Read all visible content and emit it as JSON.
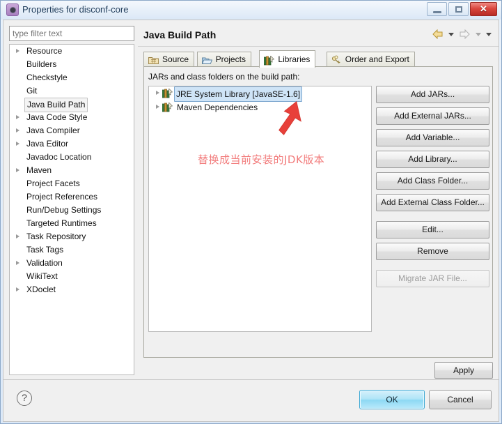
{
  "window": {
    "title": "Properties for disconf-core",
    "icon": "properties-icon",
    "controls": {
      "minimize": "minimize-button",
      "maximize": "maximize-button",
      "close": "✕"
    }
  },
  "sidebar": {
    "filter": {
      "value": "",
      "placeholder": "type filter text"
    },
    "items": [
      {
        "label": "Resource",
        "expandable": true,
        "selected": false
      },
      {
        "label": "Builders",
        "expandable": false,
        "selected": false
      },
      {
        "label": "Checkstyle",
        "expandable": false,
        "selected": false
      },
      {
        "label": "Git",
        "expandable": false,
        "selected": false
      },
      {
        "label": "Java Build Path",
        "expandable": false,
        "selected": true
      },
      {
        "label": "Java Code Style",
        "expandable": true,
        "selected": false
      },
      {
        "label": "Java Compiler",
        "expandable": true,
        "selected": false
      },
      {
        "label": "Java Editor",
        "expandable": true,
        "selected": false
      },
      {
        "label": "Javadoc Location",
        "expandable": false,
        "selected": false
      },
      {
        "label": "Maven",
        "expandable": true,
        "selected": false
      },
      {
        "label": "Project Facets",
        "expandable": false,
        "selected": false
      },
      {
        "label": "Project References",
        "expandable": false,
        "selected": false
      },
      {
        "label": "Run/Debug Settings",
        "expandable": false,
        "selected": false
      },
      {
        "label": "Targeted Runtimes",
        "expandable": false,
        "selected": false
      },
      {
        "label": "Task Repository",
        "expandable": true,
        "selected": false
      },
      {
        "label": "Task Tags",
        "expandable": false,
        "selected": false
      },
      {
        "label": "Validation",
        "expandable": true,
        "selected": false
      },
      {
        "label": "WikiText",
        "expandable": false,
        "selected": false
      },
      {
        "label": "XDoclet",
        "expandable": true,
        "selected": false
      }
    ]
  },
  "page": {
    "title": "Java Build Path",
    "nav": {
      "back": "back-arrow-icon",
      "back_menu": "chevron-down-icon",
      "forward": "forward-arrow-icon",
      "forward_menu": "chevron-down-icon",
      "view_menu": "chevron-down-icon"
    },
    "tabs": [
      {
        "label": "Source",
        "icon": "source-folder-icon",
        "active": false
      },
      {
        "label": "Projects",
        "icon": "open-folder-icon",
        "active": false
      },
      {
        "label": "Libraries",
        "icon": "library-books-icon",
        "active": true
      },
      {
        "label": "Order and Export",
        "icon": "order-export-icon",
        "active": false
      }
    ],
    "panel_label": "JARs and class folders on the build path:",
    "libraries": [
      {
        "label": "JRE System Library [JavaSE-1.6]",
        "icon": "library-books-icon",
        "expandable": true,
        "selected": true
      },
      {
        "label": "Maven Dependencies",
        "icon": "library-books-icon",
        "expandable": true,
        "selected": false
      }
    ],
    "buttons": [
      {
        "label": "Add JARs...",
        "enabled": true,
        "gap": false
      },
      {
        "label": "Add External JARs...",
        "enabled": true,
        "gap": false
      },
      {
        "label": "Add Variable...",
        "enabled": true,
        "gap": false
      },
      {
        "label": "Add Library...",
        "enabled": true,
        "gap": false
      },
      {
        "label": "Add Class Folder...",
        "enabled": true,
        "gap": false
      },
      {
        "label": "Add External Class Folder...",
        "enabled": true,
        "gap": false
      },
      {
        "label": "Edit...",
        "enabled": true,
        "gap": true
      },
      {
        "label": "Remove",
        "enabled": true,
        "gap": false
      },
      {
        "label": "Migrate JAR File...",
        "enabled": false,
        "gap": true
      }
    ],
    "apply_label": "Apply"
  },
  "footer": {
    "help": "?",
    "ok_label": "OK",
    "cancel_label": "Cancel"
  },
  "annotation": {
    "text": "替换成当前安装的JDK版本",
    "color": "#f27c7c",
    "arrow": "red-arrow-annotation"
  }
}
